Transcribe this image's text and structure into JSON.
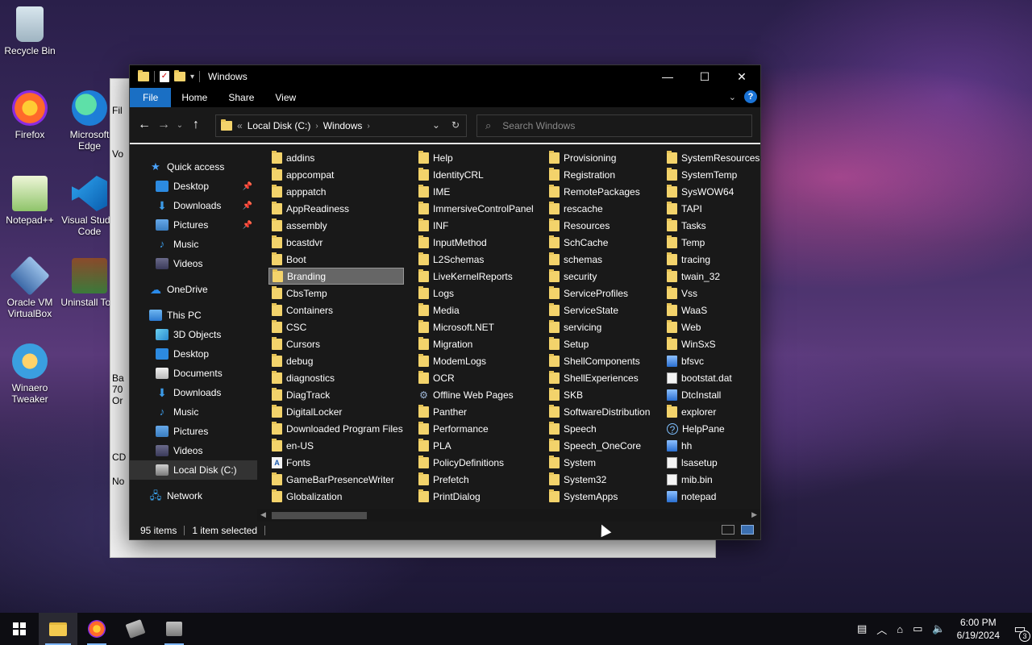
{
  "desktop": {
    "icons": [
      {
        "label": "Recycle Bin"
      },
      {
        "label": "Firefox"
      },
      {
        "label": "Microsoft Edge"
      },
      {
        "label": "Notepad++"
      },
      {
        "label": "Visual Studio Code"
      },
      {
        "label": "Oracle VM VirtualBox"
      },
      {
        "label": "Uninstall Tool"
      },
      {
        "label": "Winaero Tweaker"
      }
    ]
  },
  "bg_window": {
    "fragments": [
      "Fil",
      "Vo",
      "Ba",
      "70",
      "Or",
      "CD",
      "No"
    ]
  },
  "explorer": {
    "title": "Windows",
    "window_buttons": {
      "minimize": "—",
      "maximize": "☐",
      "close": "✕"
    },
    "ribbon_tabs": [
      "File",
      "Home",
      "Share",
      "View"
    ],
    "address": {
      "crumbs": [
        "Local Disk (C:)",
        "Windows"
      ],
      "separator": "«"
    },
    "search_placeholder": "Search Windows",
    "nav": {
      "quick_access": "Quick access",
      "quick_items": [
        "Desktop",
        "Downloads",
        "Pictures",
        "Music",
        "Videos"
      ],
      "onedrive": "OneDrive",
      "this_pc": "This PC",
      "pc_items": [
        "3D Objects",
        "Desktop",
        "Documents",
        "Downloads",
        "Music",
        "Pictures",
        "Videos",
        "Local Disk (C:)"
      ],
      "network": "Network"
    },
    "columns": [
      [
        "addins",
        "appcompat",
        "apppatch",
        "AppReadiness",
        "assembly",
        "bcastdvr",
        "Boot",
        "Branding",
        "CbsTemp",
        "Containers",
        "CSC",
        "Cursors",
        "debug",
        "diagnostics",
        "DiagTrack",
        "DigitalLocker",
        "Downloaded Program Files",
        "en-US",
        "Fonts",
        "GameBarPresenceWriter",
        "Globalization"
      ],
      [
        "Help",
        "IdentityCRL",
        "IME",
        "ImmersiveControlPanel",
        "INF",
        "InputMethod",
        "L2Schemas",
        "LiveKernelReports",
        "Logs",
        "Media",
        "Microsoft.NET",
        "Migration",
        "ModemLogs",
        "OCR",
        "Offline Web Pages",
        "Panther",
        "Performance",
        "PLA",
        "PolicyDefinitions",
        "Prefetch",
        "PrintDialog"
      ],
      [
        "Provisioning",
        "Registration",
        "RemotePackages",
        "rescache",
        "Resources",
        "SchCache",
        "schemas",
        "security",
        "ServiceProfiles",
        "ServiceState",
        "servicing",
        "Setup",
        "ShellComponents",
        "ShellExperiences",
        "SKB",
        "SoftwareDistribution",
        "Speech",
        "Speech_OneCore",
        "System",
        "System32",
        "SystemApps"
      ],
      [
        "SystemResources",
        "SystemTemp",
        "SysWOW64",
        "TAPI",
        "Tasks",
        "Temp",
        "tracing",
        "twain_32",
        "Vss",
        "WaaS",
        "Web",
        "WinSxS",
        "bfsvc",
        "bootstat.dat",
        "DtcInstall",
        "explorer",
        "HelpPane",
        "hh",
        "lsasetup",
        "mib.bin",
        "notepad"
      ]
    ],
    "selected_item": "Branding",
    "status": {
      "count": "95 items",
      "selection": "1 item selected"
    }
  },
  "taskbar": {
    "time": "6:00 PM",
    "date": "6/19/2024",
    "notification_count": "3"
  },
  "colors": {
    "accent": "#1a6fc4",
    "folder": "#f3d36b"
  }
}
